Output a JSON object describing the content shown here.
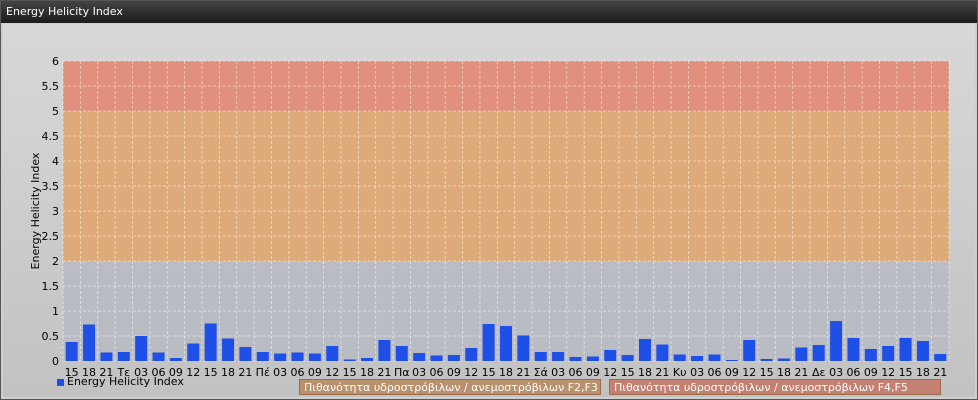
{
  "window": {
    "title": "Energy Helicity Index"
  },
  "legend": {
    "series_label": "Energy Helicity Index",
    "band_f2f3": "Πιθανότητα υδροστρόβιλων / ανεμοστρόβιλων F2,F3",
    "band_f4f5": "Πιθανότητα υδροστρόβιλων / ανεμοστρόβιλων F4,F5"
  },
  "colors": {
    "bar": "#1e4fe6",
    "band_low": "#b8bcc2",
    "band_mid": "#dea874",
    "band_high": "#e08c78",
    "grid": "#ffffff"
  },
  "chart_data": {
    "type": "bar",
    "ylabel": "Energy Helicity Index",
    "ylim": [
      0,
      6
    ],
    "yticks": [
      "0",
      "0.5",
      "1",
      "1.5",
      "2",
      "2.5",
      "3",
      "3.5",
      "4",
      "4.5",
      "5",
      "5.5",
      "6"
    ],
    "bands": [
      {
        "from": 0,
        "to": 2,
        "label": ""
      },
      {
        "from": 2,
        "to": 5,
        "label": "Πιθανότητα υδροστρόβιλων / ανεμοστρόβιλων F2,F3"
      },
      {
        "from": 5,
        "to": 6,
        "label": "Πιθανότητα υδροστρόβιλων / ανεμοστρόβιλων F4,F5"
      }
    ],
    "categories": [
      "15",
      "18",
      "21",
      "Τε",
      "03",
      "06",
      "09",
      "12",
      "15",
      "18",
      "21",
      "Πέ",
      "03",
      "06",
      "09",
      "12",
      "15",
      "18",
      "21",
      "Πα",
      "03",
      "06",
      "09",
      "12",
      "15",
      "18",
      "21",
      "Σά",
      "03",
      "06",
      "09",
      "12",
      "15",
      "18",
      "21",
      "Κυ",
      "03",
      "06",
      "09",
      "12",
      "15",
      "18",
      "21",
      "Δε",
      "03",
      "06",
      "09",
      "12",
      "15",
      "18",
      "21"
    ],
    "values": [
      0.38,
      0.73,
      0.17,
      0.18,
      0.5,
      0.17,
      0.06,
      0.35,
      0.75,
      0.45,
      0.28,
      0.18,
      0.15,
      0.17,
      0.15,
      0.3,
      0.03,
      0.06,
      0.42,
      0.3,
      0.16,
      0.11,
      0.12,
      0.26,
      0.74,
      0.7,
      0.51,
      0.18,
      0.18,
      0.08,
      0.09,
      0.22,
      0.12,
      0.44,
      0.33,
      0.13,
      0.1,
      0.13,
      0.02,
      0.42,
      0.04,
      0.05,
      0.27,
      0.32,
      0.8,
      0.46,
      0.24,
      0.3,
      0.46,
      0.4,
      0.14
    ],
    "grid": true,
    "legend_position": "bottom-left"
  }
}
